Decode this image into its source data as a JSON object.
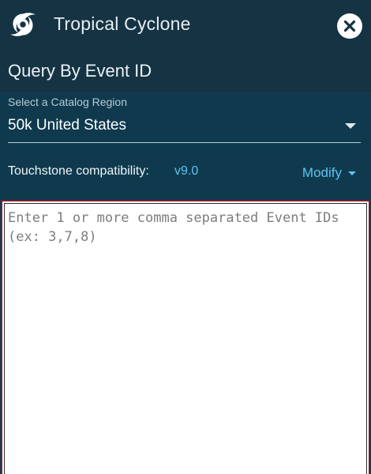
{
  "header": {
    "app_title": "Tropical Cyclone",
    "logo_icon": "hurricane-icon",
    "close_icon": "close-icon",
    "subtitle": "Query By Event ID"
  },
  "region": {
    "label": "Select a Catalog Region",
    "selected": "50k United States"
  },
  "compatibility": {
    "label": "Touchstone compatibility:",
    "version": "v9.0",
    "modify_label": "Modify"
  },
  "event_ids": {
    "value": "",
    "placeholder": "Enter 1 or more comma separated Event IDs (ex: 3,7,8)"
  },
  "colors": {
    "panel_bg": "#0f3a4e",
    "header_bg": "#153343",
    "accent": "#5ec3f0",
    "textarea_border": "#7a1f2a"
  }
}
